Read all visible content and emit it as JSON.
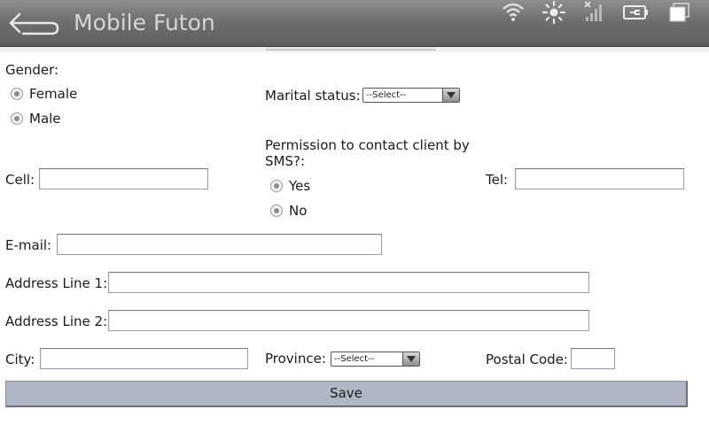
{
  "app": {
    "title": "Mobile Futon"
  },
  "status_bar": {
    "icons": [
      "wifi-icon",
      "brightness-icon",
      "no-signal-icon",
      "battery-charging-icon",
      "recent-apps-icon"
    ]
  },
  "form": {
    "gender": {
      "label": "Gender:",
      "options": [
        "Female",
        "Male"
      ]
    },
    "marital_status": {
      "label": "Marital status:",
      "selected": "--Select--"
    },
    "cell": {
      "label": "Cell:",
      "value": ""
    },
    "sms_permission": {
      "label_line1": "Permission to contact client by",
      "label_line2": "SMS?:",
      "options": [
        "Yes",
        "No"
      ]
    },
    "tel": {
      "label": "Tel:",
      "value": ""
    },
    "email": {
      "label": "E-mail:",
      "value": ""
    },
    "address1": {
      "label": "Address Line 1:",
      "value": ""
    },
    "address2": {
      "label": "Address Line 2:",
      "value": ""
    },
    "city": {
      "label": "City:",
      "value": ""
    },
    "province": {
      "label": "Province:",
      "selected": "--Select--"
    },
    "postal_code": {
      "label": "Postal Code:",
      "value": ""
    },
    "save_label": "Save"
  },
  "colors": {
    "titlebar": "#6f6f6f",
    "save_button": "#b0b6c4"
  }
}
